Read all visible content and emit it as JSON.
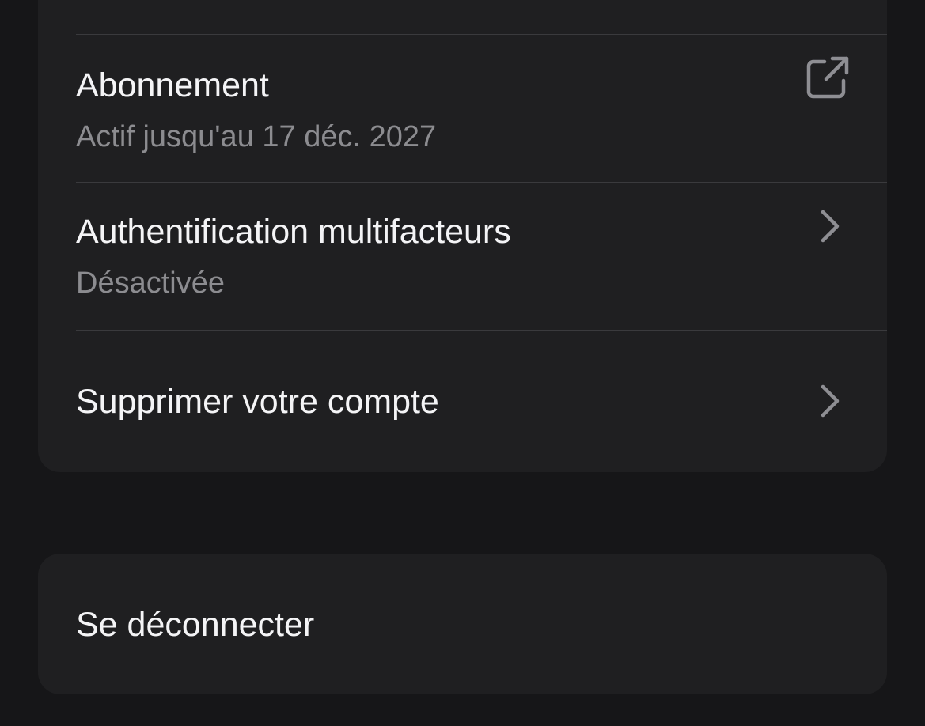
{
  "account_section": {
    "items": [
      {
        "label": "Abonnement",
        "sublabel": "Actif jusqu'au 17 déc. 2027",
        "icon": "external-link-icon"
      },
      {
        "label": "Authentification multifacteurs",
        "sublabel": "Désactivée",
        "icon": "chevron-right-icon"
      },
      {
        "label": "Supprimer votre compte",
        "icon": "chevron-right-icon"
      }
    ]
  },
  "session_section": {
    "logout_label": "Se déconnecter"
  },
  "colors": {
    "background": "#161618",
    "card": "#1f1f21",
    "divider": "#3a3a3d",
    "primary_text": "#f4f4f6",
    "secondary_text": "#8c8c90",
    "icon": "#8e8e93"
  }
}
